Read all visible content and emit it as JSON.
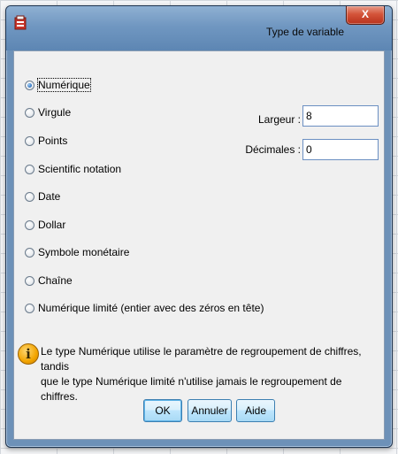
{
  "window": {
    "title": "Type de variable",
    "close_label": "X"
  },
  "types": [
    {
      "label": "Numérique",
      "checked": true
    },
    {
      "label": "Virgule",
      "checked": false
    },
    {
      "label": "Points",
      "checked": false
    },
    {
      "label": "Scientific notation",
      "checked": false
    },
    {
      "label": "Date",
      "checked": false
    },
    {
      "label": "Dollar",
      "checked": false
    },
    {
      "label": "Symbole monétaire",
      "checked": false
    },
    {
      "label": "Chaîne",
      "checked": false
    },
    {
      "label": "Numérique limité (entier avec des zéros en tête)",
      "checked": false
    }
  ],
  "fields": {
    "largeur_label": "Largeur :",
    "largeur_value": "8",
    "decimales_label": "Décimales :",
    "decimales_value": "0"
  },
  "info": {
    "line1": "Le type Numérique utilise le paramètre de regroupement de chiffres, tandis",
    "line2": "que le type Numérique limité n'utilise jamais le regroupement de chiffres."
  },
  "buttons": {
    "ok": "OK",
    "cancel": "Annuler",
    "help": "Aide"
  },
  "colors": {
    "title_bar": "#7097c1",
    "close_button": "#d4543a",
    "dialog_body": "#f0f0f0",
    "button_border": "#3c7fb1",
    "info_icon": "#f2a400"
  }
}
